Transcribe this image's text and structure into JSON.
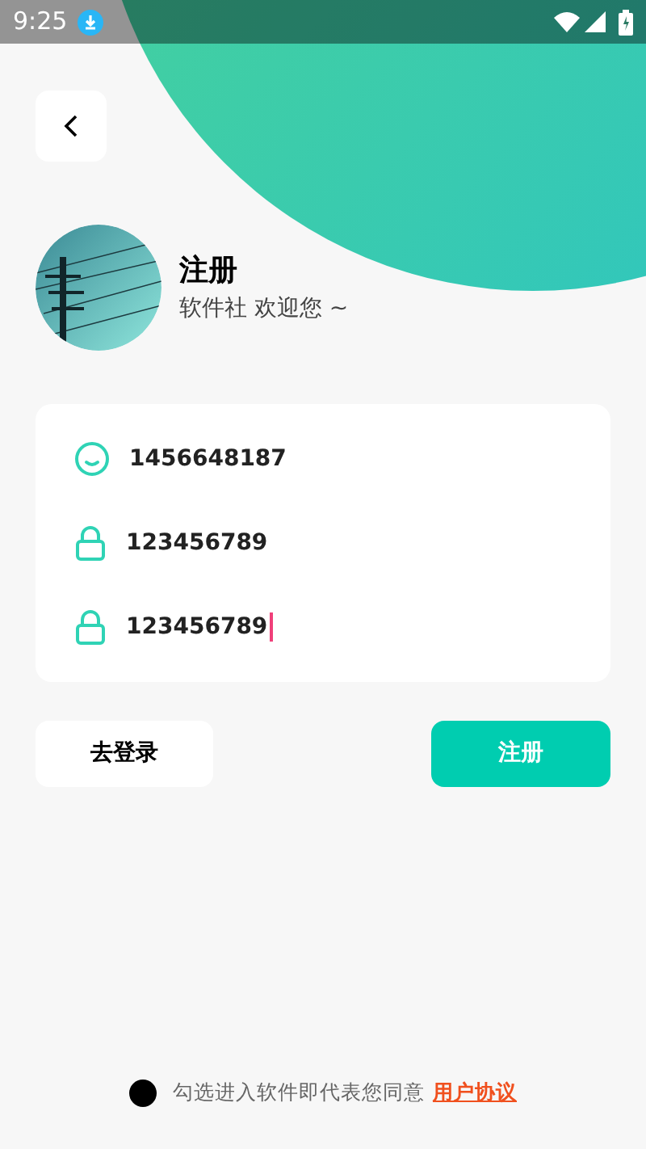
{
  "status_bar": {
    "time": "9:25"
  },
  "header": {
    "title": "注册",
    "subtitle": "软件社 欢迎您 ~"
  },
  "form": {
    "fields": [
      {
        "kind": "account",
        "value": "1456648187",
        "focused": false
      },
      {
        "kind": "password",
        "value": "123456789",
        "focused": false
      },
      {
        "kind": "password",
        "value": "123456789",
        "focused": true
      }
    ]
  },
  "buttons": [
    {
      "label": "去登录",
      "primary": false
    },
    {
      "label": "注册",
      "primary": true
    }
  ],
  "agreement": {
    "checked": false,
    "text": "勾选进入软件即代表您同意",
    "link": "用户协议"
  }
}
